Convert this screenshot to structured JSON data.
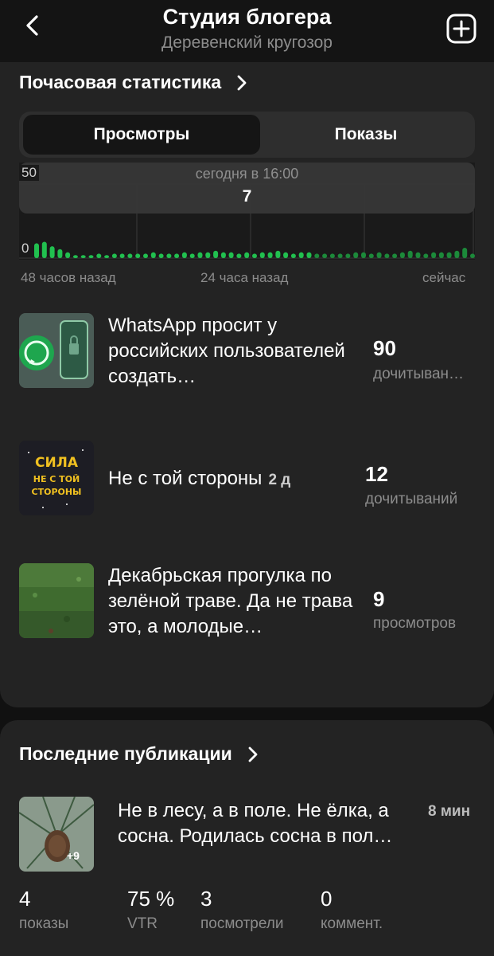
{
  "header": {
    "title": "Студия блогера",
    "subtitle": "Деревенский кругозор"
  },
  "hourly": {
    "section_title": "Почасовая статистика",
    "tabs": [
      "Просмотры",
      "Показы"
    ],
    "active_tab": 0,
    "tooltip_time": "сегодня в 16:00",
    "tooltip_value": "7",
    "x_labels": [
      "48 часов назад",
      "24 часа назад",
      "сейчас"
    ],
    "y_max_label": "50",
    "y_min_label": "0"
  },
  "chart_data": {
    "type": "bar",
    "ylim": [
      0,
      50
    ],
    "xlabel": "",
    "ylabel": "",
    "x_ticks": [
      "48 часов назад",
      "24 часа назад",
      "сейчас"
    ],
    "values": [
      10,
      11,
      8,
      6,
      4,
      2,
      2,
      2,
      3,
      2,
      3,
      3,
      3,
      3,
      3,
      4,
      3,
      3,
      3,
      4,
      3,
      4,
      4,
      5,
      4,
      4,
      3,
      4,
      3,
      4,
      4,
      5,
      4,
      3,
      4,
      4,
      3,
      3,
      3,
      3,
      3,
      4,
      4,
      3,
      4,
      3,
      3,
      4,
      5,
      4,
      3,
      4,
      4,
      4,
      5,
      7,
      3
    ],
    "series_colors": [
      "#21c04f",
      "#1c8a3a"
    ]
  },
  "top_articles": [
    {
      "title": "WhatsApp просит у российских пользователей создать…",
      "age": "",
      "count": "90",
      "metric": "дочитыван…"
    },
    {
      "title": "Не с той стороны",
      "age": "2 д",
      "count": "12",
      "metric": "дочитываний"
    },
    {
      "title": "Декабрьская прогулка по зелёной траве. Да не трава это, а молодые…",
      "age": "",
      "count": "9",
      "metric": "просмотров"
    }
  ],
  "thumb2_text": [
    "СИЛА",
    "НЕ С ТОЙ",
    "СТОРОНЫ"
  ],
  "recent": {
    "section_title": "Последние публикации",
    "item": {
      "title": "Не в лесу, а в поле. Не ёлка, а сосна. Родилась сосна в пол…",
      "time": "8 мин",
      "badge": "+9"
    },
    "metrics": [
      {
        "value": "4",
        "label": "показы"
      },
      {
        "value": "75 %",
        "label": "VTR"
      },
      {
        "value": "3",
        "label": "посмотрели"
      },
      {
        "value": "0",
        "label": "коммент."
      }
    ]
  },
  "icons": {
    "back": "chevron-left-icon",
    "add": "plus-square-icon",
    "section_arrow": "chevron-right-icon"
  }
}
